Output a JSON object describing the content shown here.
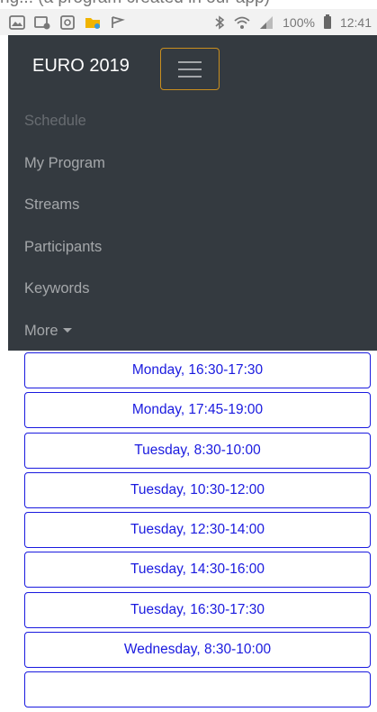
{
  "top_strip": {
    "cut_text": "ng... (a program created in our app)"
  },
  "status_bar": {
    "left_icons": [
      "gallery-icon",
      "image-icon",
      "cast-icon",
      "folder-icon",
      "flag-icon"
    ],
    "right_icons": [
      "bluetooth-icon",
      "wifi-icon",
      "signal-icon",
      "battery-icon"
    ],
    "battery_text": "100%",
    "time": "12:41"
  },
  "navbar": {
    "brand": "EURO 2019",
    "links": [
      {
        "label": "Schedule",
        "active": true
      },
      {
        "label": "My Program"
      },
      {
        "label": "Streams"
      },
      {
        "label": "Participants"
      },
      {
        "label": "Keywords"
      },
      {
        "label": "More"
      }
    ]
  },
  "sessions": [
    "Monday, 16:30-17:30",
    "Monday, 17:45-19:00",
    "Tuesday, 8:30-10:00",
    "Tuesday, 10:30-12:00",
    "Tuesday, 12:30-14:00",
    "Tuesday, 14:30-16:00",
    "Tuesday, 16:30-17:30",
    "Wednesday, 8:30-10:00",
    ""
  ],
  "colors": {
    "navbar_bg": "#343a40",
    "toggler_border": "#c98e1f",
    "session_accent": "#1a1adf"
  }
}
